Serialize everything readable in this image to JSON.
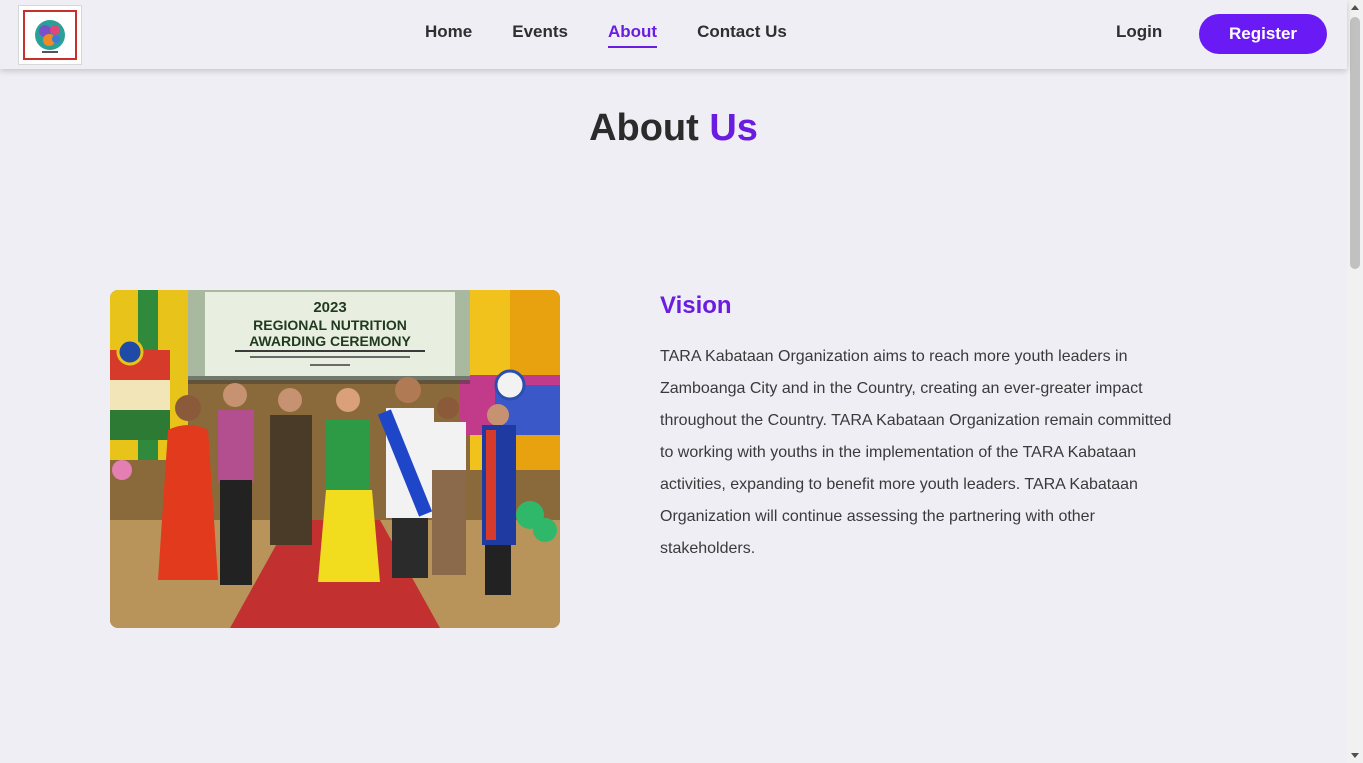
{
  "nav": {
    "links": [
      {
        "label": "Home"
      },
      {
        "label": "Events"
      },
      {
        "label": "About"
      },
      {
        "label": "Contact Us"
      }
    ],
    "active": "About",
    "login_label": "Login",
    "register_label": "Register"
  },
  "page": {
    "title_main": "About",
    "title_accent": "Us"
  },
  "photo": {
    "banner_year": "2023",
    "banner_line1": "REGIONAL NUTRITION",
    "banner_line2": "AWARDING CEREMONY"
  },
  "vision": {
    "heading": "Vision",
    "body": "TARA Kabataan Organization aims to reach more youth leaders in Zamboanga City and in the Country, creating an ever-greater impact throughout the Country. TARA Kabataan Organization remain committed to working with youths in the implementation of the TARA Kabataan activities, expanding to benefit more youth leaders. TARA Kabataan Organization will continue assessing the partnering with other stakeholders."
  },
  "colors": {
    "accent": "#6a1de0",
    "register_button": "#6a1bf5",
    "background": "#efeef5"
  }
}
